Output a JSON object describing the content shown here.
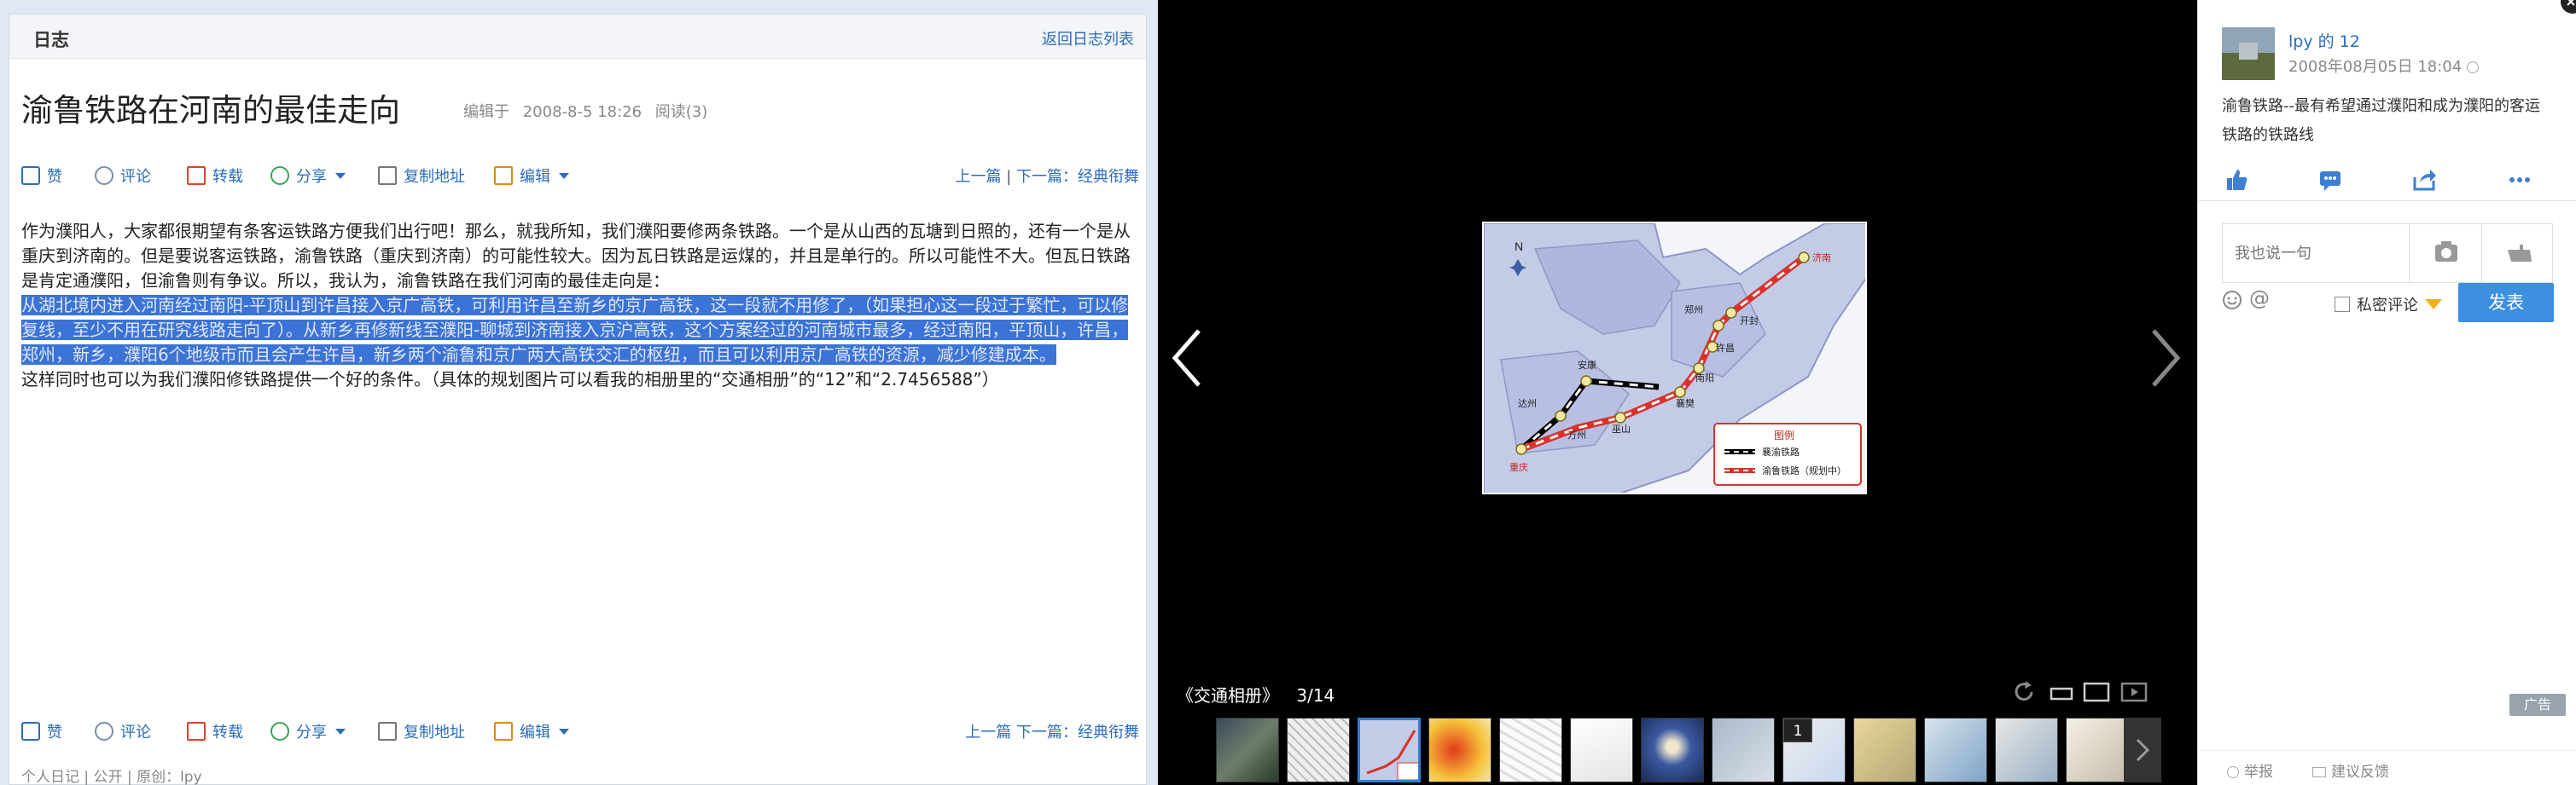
{
  "blog": {
    "header_label": "日志",
    "back_link": "返回日志列表",
    "title": "渝鲁铁路在河南的最佳走向",
    "meta": {
      "edited": "编辑于",
      "date": "2008-8-5 18:26",
      "reads": "阅读(3)"
    },
    "actions": {
      "like": "赞",
      "comment": "评论",
      "repost": "转载",
      "share": "分享",
      "copy": "复制地址",
      "edit": "编辑"
    },
    "nav": {
      "prev": "上一篇",
      "sep": "|",
      "next": "下一篇：经典衔舞"
    },
    "nav_bottom": "上一篇 下一篇：经典衔舞",
    "paragraph1": "作为濮阳人，大家都很期望有条客运铁路方便我们出行吧！那么，就我所知，我们濮阳要修两条铁路。一个是从山西的瓦塘到日照的，还有一个是从重庆到济南的。但是要说客运铁路，渝鲁铁路（重庆到济南）的可能性较大。因为瓦日铁路是运煤的，并且是单行的。所以可能性不大。但瓦日铁路是肯定通濮阳，但渝鲁则有争议。所以，我认为，渝鲁铁路在我们河南的最佳走向是：",
    "paragraph_selected": "从湖北境内进入河南经过南阳-平顶山到许昌接入京广高铁，可利用许昌至新乡的京广高铁，这一段就不用修了，（如果担心这一段过于繁忙，可以修复线，至少不用在研究线路走向了）。从新乡再修新线至濮阳-聊城到济南接入京沪高铁，这个方案经过的河南城市最多，经过南阳，平顶山，许昌，郑州，新乡，濮阳6个地级市而且会产生许昌，新乡两个渝鲁和京广两大高铁交汇的枢纽，而且可以利用京广高铁的资源，减少修建成本。",
    "paragraph2": "这样同时也可以为我们濮阳修铁路提供一个好的条件。（具体的规划图片可以看我的相册里的“交通相册”的“12”和“2.7456588”）",
    "footer": "个人日记 | 公开 | 原创：lpy"
  },
  "viewer": {
    "album": "《交通相册》",
    "counter": "3/14",
    "thumb_badge": "1",
    "map_labels": {
      "north": "N",
      "jinan": "济南",
      "zhengzhou": "郑州",
      "kaifeng": "开封",
      "xuchang": "许昌",
      "anyang": "安康",
      "dazhou": "达州",
      "wanzhou": "万州",
      "chongqing": "重庆",
      "nanyang": "南阳",
      "xiangfan": "襄樊",
      "jiangshan": "巫山",
      "legend_title": "图例",
      "legend_1": "襄渝铁路",
      "legend_2": "渝鲁铁路（规划中）"
    }
  },
  "sidebar": {
    "user": "lpy 的 12",
    "date": "2008年08月05日 18:04",
    "description": "渝鲁铁路--最有希望通过濮阳和成为濮阳的客运铁路的铁路线",
    "comment_placeholder": "我也说一句",
    "private_label": "私密评论",
    "send": "发表",
    "ad": "广告",
    "report": "举报",
    "feedback": "建议反馈"
  },
  "colors": {
    "link": "#2b6db8",
    "selection": "#3b73d6",
    "send": "#3d8fe0",
    "rail_red": "#d8322a"
  }
}
